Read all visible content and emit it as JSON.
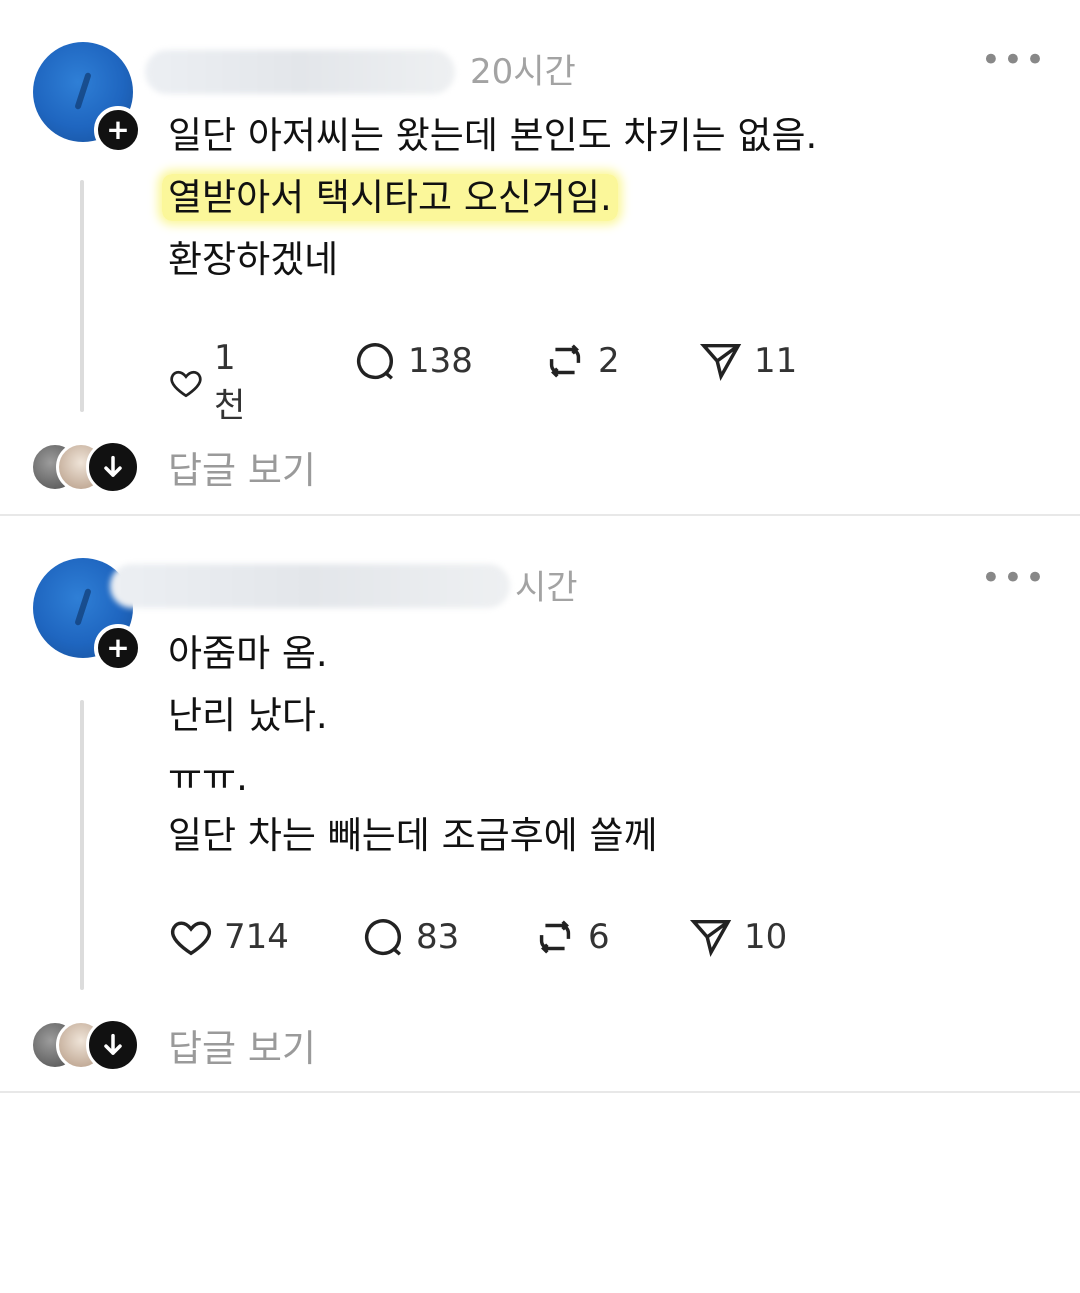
{
  "posts": [
    {
      "time": "20시간",
      "lines": [
        "일단 아저씨는 왔는데 본인도 차키는 없음.",
        "열받아서 택시타고 오신거임.",
        "환장하겠네"
      ],
      "likes": "1천",
      "comments": "138",
      "reposts": "2",
      "shares": "11",
      "view_replies": "답글 보기"
    },
    {
      "time": "시간",
      "lines": [
        "아줌마 옴.",
        "난리 났다.",
        "ㅠㅠ.",
        "일단 차는 빼는데 조금후에 쓸께"
      ],
      "likes": "714",
      "comments": "83",
      "reposts": "6",
      "shares": "10",
      "view_replies": "답글 보기"
    }
  ],
  "more_label": "•••",
  "highlight_color": "#fbf79a"
}
